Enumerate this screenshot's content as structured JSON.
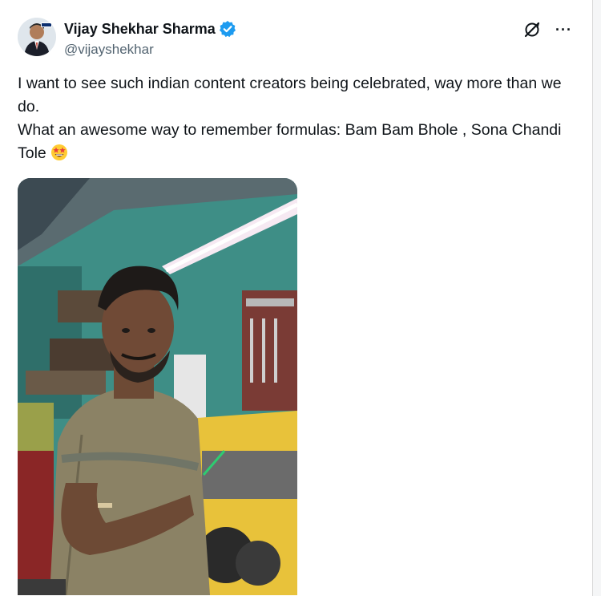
{
  "author": {
    "display_name": "Vijay Shekhar Sharma",
    "handle": "@vijayshekhar",
    "avatar_badge": "PAYTM"
  },
  "actions": {
    "grok_icon": "grok-slash-circle-icon",
    "more_icon": "more-horizontal-icon",
    "more_label": "···"
  },
  "tweet": {
    "line1": "I want to see such indian content creators being celebrated, way more than we do.",
    "line2": "What an awesome way to remember formulas: Bam Bam Bhole , Sona Chandi Tole",
    "emoji": "star-struck-emoji"
  },
  "media": {
    "type": "video-thumbnail",
    "description_icon": "video-media"
  },
  "colors": {
    "text_primary": "#0f1419",
    "text_secondary": "#536471",
    "verified_blue": "#1d9bf0"
  }
}
